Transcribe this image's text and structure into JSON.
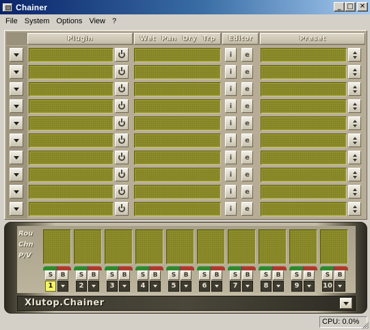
{
  "window": {
    "title": "Chainer",
    "controls": {
      "minimize": "_",
      "maximize": "□",
      "close": "✕"
    }
  },
  "menu": [
    "File",
    "System",
    "Options",
    "View",
    "?"
  ],
  "headers": {
    "plugin": "Plugin",
    "fx": [
      "Wet",
      "Pan",
      "Dry",
      "Trp"
    ],
    "editor": "Editor",
    "preset": "Preset"
  },
  "rows": [
    {
      "plugin": "",
      "fx": "",
      "preset": ""
    },
    {
      "plugin": "",
      "fx": "",
      "preset": ""
    },
    {
      "plugin": "",
      "fx": "",
      "preset": ""
    },
    {
      "plugin": "",
      "fx": "",
      "preset": ""
    },
    {
      "plugin": "",
      "fx": "",
      "preset": ""
    },
    {
      "plugin": "",
      "fx": "",
      "preset": ""
    },
    {
      "plugin": "",
      "fx": "",
      "preset": ""
    },
    {
      "plugin": "",
      "fx": "",
      "preset": ""
    },
    {
      "plugin": "",
      "fx": "",
      "preset": ""
    },
    {
      "plugin": "",
      "fx": "",
      "preset": ""
    }
  ],
  "row_icons": {
    "dropdown": "dropdown-arrow-icon",
    "power": "power-icon",
    "editor_a": "editor-i-icon",
    "editor_b": "editor-e-icon",
    "updown": "up-down-arrows-icon"
  },
  "editor_glyphs": [
    "i",
    "e"
  ],
  "bottom": {
    "side_labels": [
      "Rou",
      "Chn",
      "P/V"
    ],
    "mute_label": "S",
    "bypass_label": "B",
    "channels": [
      "1",
      "2",
      "3",
      "4",
      "5",
      "6",
      "7",
      "8",
      "9",
      "10"
    ],
    "active_channel": "1",
    "brand": "Xlutop.Chainer"
  },
  "colors": {
    "lcd": "#8d8d2a",
    "active_channel": "#f4f468",
    "title_start": "#0a246a",
    "title_end": "#a6caf0"
  },
  "status": {
    "cpu": "CPU: 0.0%"
  }
}
